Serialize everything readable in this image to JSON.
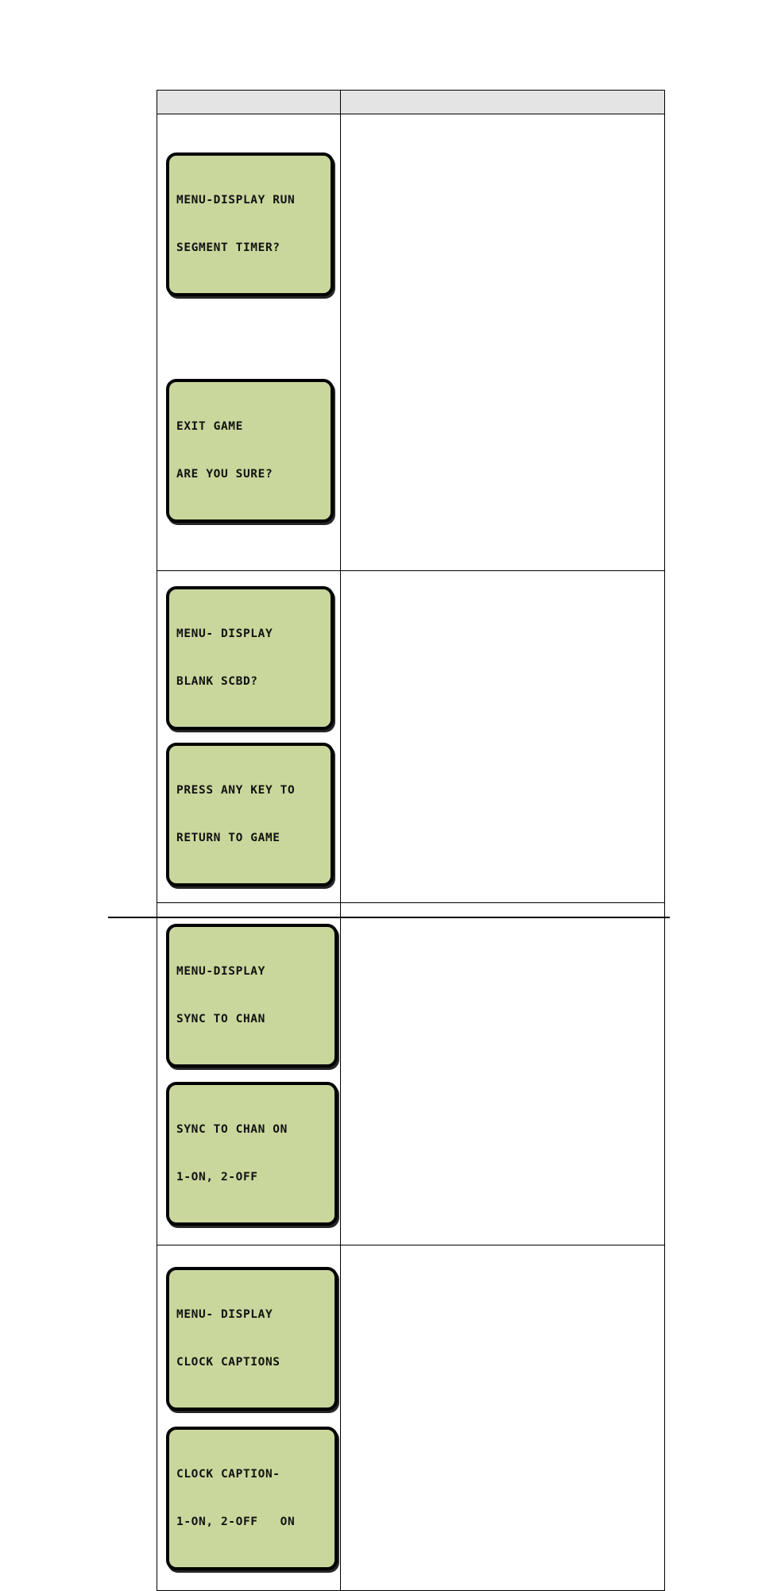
{
  "page": {
    "background_color": "#ffffff",
    "lcd_fill_color": "#c9d79c",
    "lcd_border_color": "#000000",
    "header_fill_color": "#e4e4e4",
    "table_border_color": "#000000"
  },
  "table": {
    "header": {
      "left_label": "",
      "right_label": ""
    },
    "rows": [
      {
        "id": "row-run-segment-timer",
        "displays": [
          {
            "name": "menu-display-run-segment-timer",
            "line1": "MENU-DISPLAY RUN",
            "line2": "SEGMENT TIMER?"
          },
          {
            "name": "exit-game-confirm",
            "line1": "EXIT GAME",
            "line2": "ARE YOU SURE?"
          }
        ],
        "description": ""
      },
      {
        "id": "row-blank-scoreboard",
        "displays": [
          {
            "name": "menu-display-blank-scbd",
            "line1": "MENU- DISPLAY",
            "line2": "BLANK SCBD?"
          },
          {
            "name": "press-any-key-return",
            "line1": "PRESS ANY KEY TO",
            "line2": "RETURN TO GAME"
          }
        ],
        "description": ""
      },
      {
        "id": "row-sync-to-chan",
        "displays": [
          {
            "name": "menu-display-sync-to-chan",
            "line1": "MENU-DISPLAY",
            "line2": "SYNC TO CHAN"
          },
          {
            "name": "sync-to-chan-setting",
            "line1": "SYNC TO CHAN ON",
            "line2": "1-ON, 2-OFF"
          }
        ],
        "description": ""
      },
      {
        "id": "row-clock-captions",
        "displays": [
          {
            "name": "menu-display-clock-captions",
            "line1": "MENU- DISPLAY",
            "line2": "CLOCK CAPTIONS"
          },
          {
            "name": "clock-caption-setting",
            "line1": "CLOCK CAPTION-",
            "line2": "1-ON, 2-OFF   ON"
          }
        ],
        "description": ""
      }
    ]
  },
  "footer": {
    "rule_visible": true,
    "text": ""
  }
}
